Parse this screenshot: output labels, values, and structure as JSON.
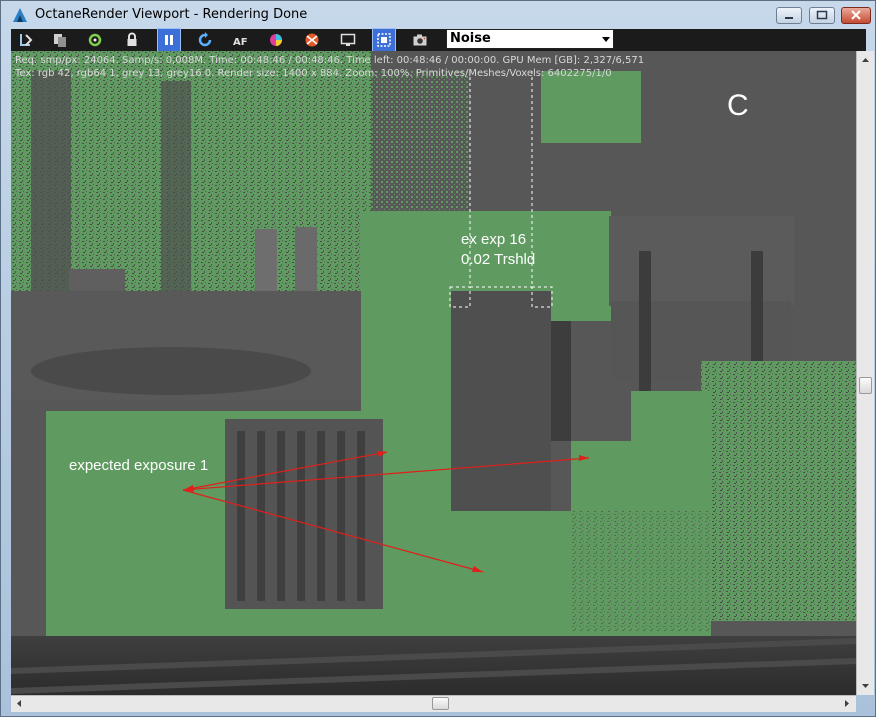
{
  "window": {
    "title": "OctaneRender Viewport - Rendering Done"
  },
  "toolbar": {
    "buttons": [
      {
        "name": "save-image-icon"
      },
      {
        "name": "copy-icon"
      },
      {
        "name": "recenter-icon"
      },
      {
        "name": "lock-icon"
      },
      {
        "name": "pause-icon"
      },
      {
        "name": "restart-icon"
      },
      {
        "name": "af-icon"
      },
      {
        "name": "color-picker-icon"
      },
      {
        "name": "material-ball-icon"
      },
      {
        "name": "display-icon"
      },
      {
        "name": "region-render-icon"
      },
      {
        "name": "camera-icon"
      }
    ],
    "render_pass": {
      "selected": "Noise"
    }
  },
  "stats": {
    "line1": "Req. smp/px: 24064.   Samp/s: 0,008M.   Time: 00:48:46 / 00:48:46.   Time left: 00:48:46 / 00:00:00.   GPU Mem [GB]: 2,327/6,571",
    "line2": "Tex: rgb 42, rgb64 1, grey 13, grey16 0.   Render size: 1400 x 884.   Zoom: 100%.   Primitives/Meshes/Voxels: 6402275/1/0"
  },
  "annotations": {
    "corner_letter": "C",
    "ex_exp_line1": "ex exp 16",
    "ex_exp_line2": "0.02 Trshld",
    "expected_exposure": "expected exposure 1"
  },
  "colors": {
    "noise_green": "#5f9a60",
    "arrow_red": "#e0201a",
    "toolbar_bg": "#1b1b1b",
    "active_button": "#3c6fd8"
  }
}
